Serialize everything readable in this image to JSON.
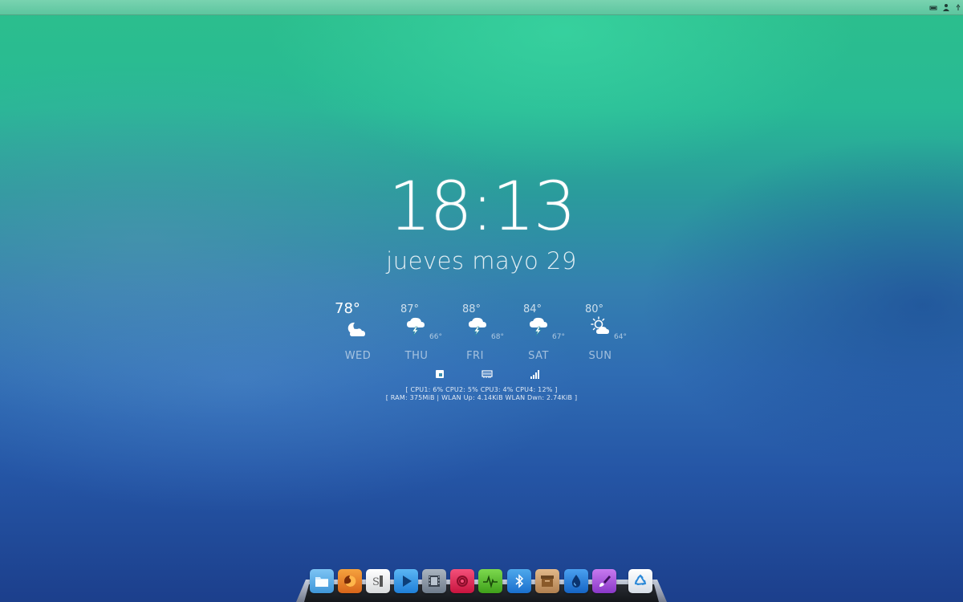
{
  "clock": {
    "time": "18:13"
  },
  "date": {
    "text": "jueves mayo 29"
  },
  "weather": {
    "days": [
      {
        "day": "WED",
        "high": "78°",
        "low": "",
        "icon": "moon-cloud-icon"
      },
      {
        "day": "THU",
        "high": "87°",
        "low": "66°",
        "icon": "thunderstorm-icon"
      },
      {
        "day": "FRI",
        "high": "88°",
        "low": "68°",
        "icon": "thunderstorm-icon"
      },
      {
        "day": "SAT",
        "high": "84°",
        "low": "67°",
        "icon": "thunderstorm-icon"
      },
      {
        "day": "SUN",
        "high": "80°",
        "low": "64°",
        "icon": "sun-cloud-icon"
      }
    ]
  },
  "system": {
    "icons": [
      "cpu-icon",
      "ram-icon",
      "wifi-signal-icon"
    ],
    "cpu_line": "[ CPU1: 6% CPU2: 5% CPU3: 4% CPU4: 12% ]",
    "net_line": "[ RAM: 375MiB | WLAN Up: 4.14KiB WLAN Dwn: 2.74KiB ]"
  },
  "top_panel": {
    "tray_icons": [
      "battery-icon",
      "user-icon",
      "network-icon"
    ]
  },
  "dock": {
    "items": [
      {
        "name": "files",
        "icon": "folder-icon",
        "color": "#5aaee8"
      },
      {
        "name": "firefox",
        "icon": "firefox-icon",
        "color": "#e8821e"
      },
      {
        "name": "scratch",
        "icon": "text-editor-icon",
        "color": "#e8e8e8"
      },
      {
        "name": "media-player",
        "icon": "play-icon",
        "color": "#2f8fe0"
      },
      {
        "name": "videos",
        "icon": "film-icon",
        "color": "#8a98a8"
      },
      {
        "name": "music",
        "icon": "music-disc-icon",
        "color": "#e8305c"
      },
      {
        "name": "system-monitor",
        "icon": "activity-icon",
        "color": "#5cc02e"
      },
      {
        "name": "bluetooth",
        "icon": "bluetooth-icon",
        "color": "#2f8fe0"
      },
      {
        "name": "archive",
        "icon": "archive-icon",
        "color": "#c79a6c"
      },
      {
        "name": "color-picker",
        "icon": "droplet-icon",
        "color": "#1f7fd8"
      },
      {
        "name": "paint",
        "icon": "brush-icon",
        "color": "#a45bd8"
      },
      {
        "name": "trash",
        "icon": "recycle-icon",
        "color": "#eef2f6"
      }
    ]
  }
}
